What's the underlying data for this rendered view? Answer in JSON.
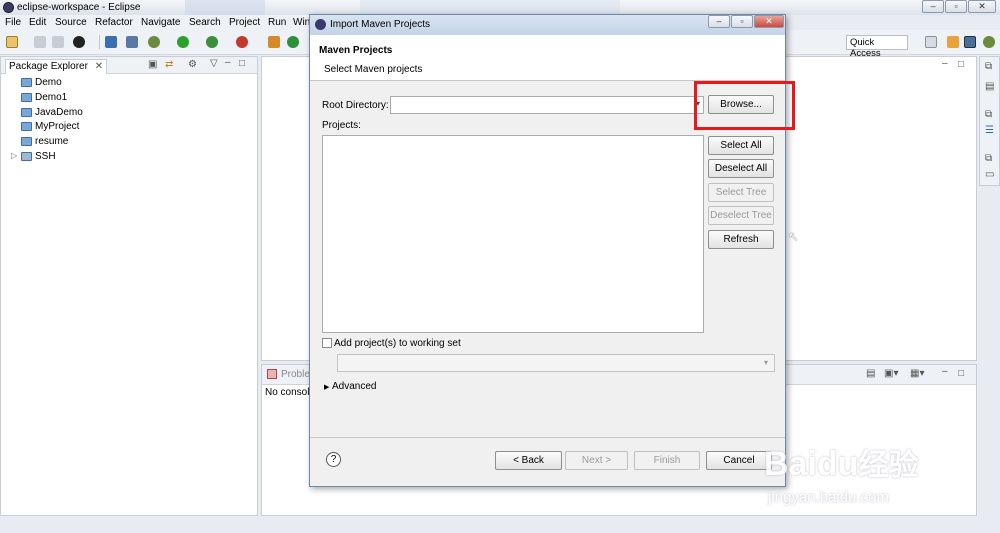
{
  "window": {
    "title": "eclipse-workspace - Eclipse"
  },
  "menu": [
    "File",
    "Edit",
    "Source",
    "Refactor",
    "Navigate",
    "Search",
    "Project",
    "Run",
    "Win"
  ],
  "quick_access": "Quick Access",
  "package_explorer": {
    "title": "Package Explorer",
    "projects": [
      "Demo",
      "Demo1",
      "JavaDemo",
      "MyProject",
      "resume",
      "SSH"
    ]
  },
  "console": {
    "tab": "Proble",
    "text": "No consol"
  },
  "dialog": {
    "title": "Import Maven Projects",
    "header_title": "Maven Projects",
    "header_subtitle": "Select Maven projects",
    "root_dir_label": "Root Directory:",
    "root_dir_value": "",
    "browse": "Browse...",
    "projects_label": "Projects:",
    "select_all": "Select All",
    "deselect_all": "Deselect All",
    "select_tree": "Select Tree",
    "deselect_tree": "Deselect Tree",
    "refresh": "Refresh",
    "working_set_label": "Add project(s) to working set",
    "advanced": "Advanced",
    "back": "< Back",
    "next": "Next >",
    "finish": "Finish",
    "cancel": "Cancel",
    "help": "?"
  },
  "watermark": {
    "brand": "Baidu",
    "cn": "经验",
    "url": "jingyan.baidu.com"
  }
}
